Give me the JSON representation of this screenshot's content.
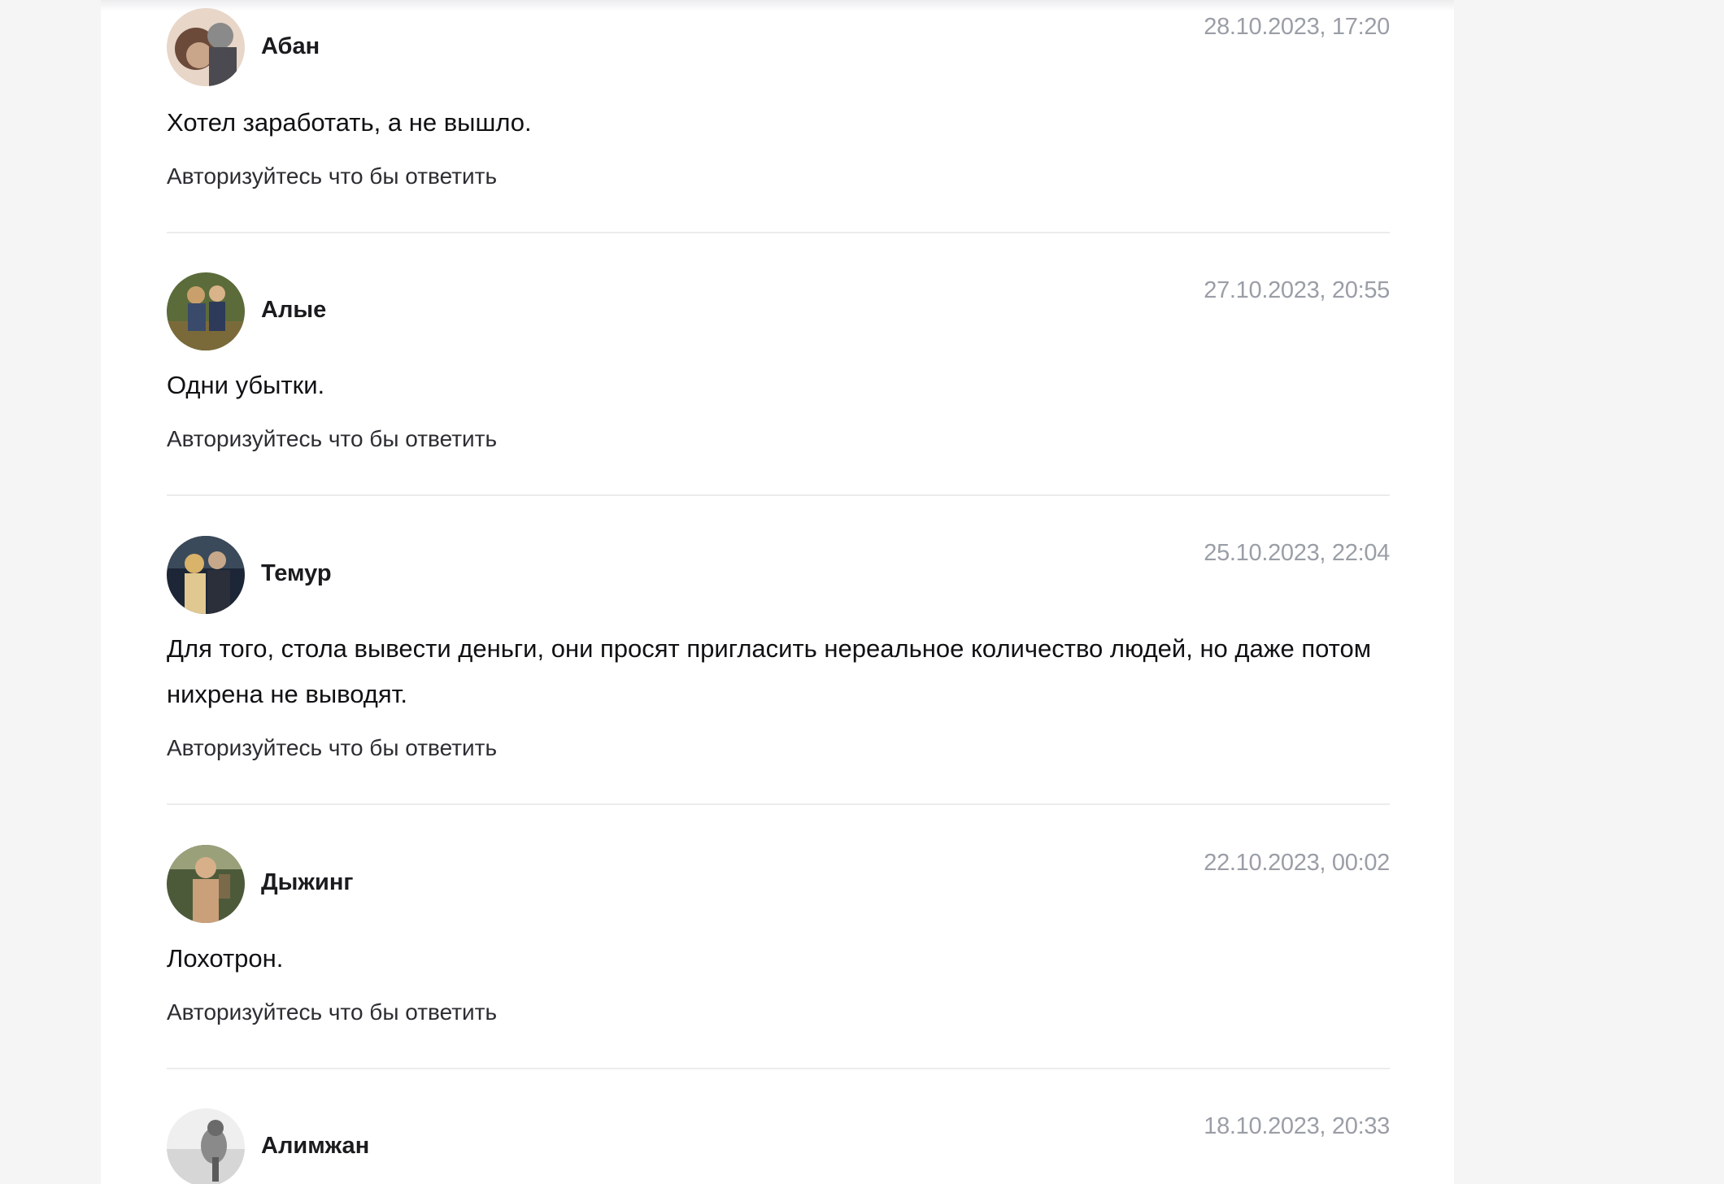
{
  "comments": [
    {
      "author": "Абан",
      "date": "28.10.2023, 17:20",
      "text": "Хотел заработать, а не вышло.",
      "reply_label": "Авторизуйтесь что бы ответить",
      "avatar_colors": [
        "#c9a589",
        "#6b4a3a",
        "#e8d6c8"
      ]
    },
    {
      "author": "Алые",
      "date": "27.10.2023, 20:55",
      "text": "Одни убытки.",
      "reply_label": "Авторизуйтесь что бы ответить",
      "avatar_colors": [
        "#5b6b3a",
        "#3a4a6b",
        "#c9a06b"
      ]
    },
    {
      "author": "Темур",
      "date": "25.10.2023, 22:04",
      "text": "Для того, стола вывести деньги, они просят пригласить нереальное количество людей, но даже потом нихрена не выводят.",
      "reply_label": "Авторизуйтесь что бы ответить",
      "avatar_colors": [
        "#2a2f3a",
        "#d9b36a",
        "#1d2636"
      ]
    },
    {
      "author": "Дыжинг",
      "date": "22.10.2023, 00:02",
      "text": "Лохотрон.",
      "reply_label": "Авторизуйтесь что бы ответить",
      "avatar_colors": [
        "#7a6a4a",
        "#d7b08a",
        "#4d5a3a"
      ]
    },
    {
      "author": "Алимжан",
      "date": "18.10.2023, 20:33",
      "text": "",
      "reply_label": "",
      "avatar_colors": [
        "#d6d6d6",
        "#8a8a8a",
        "#efefef"
      ]
    }
  ]
}
